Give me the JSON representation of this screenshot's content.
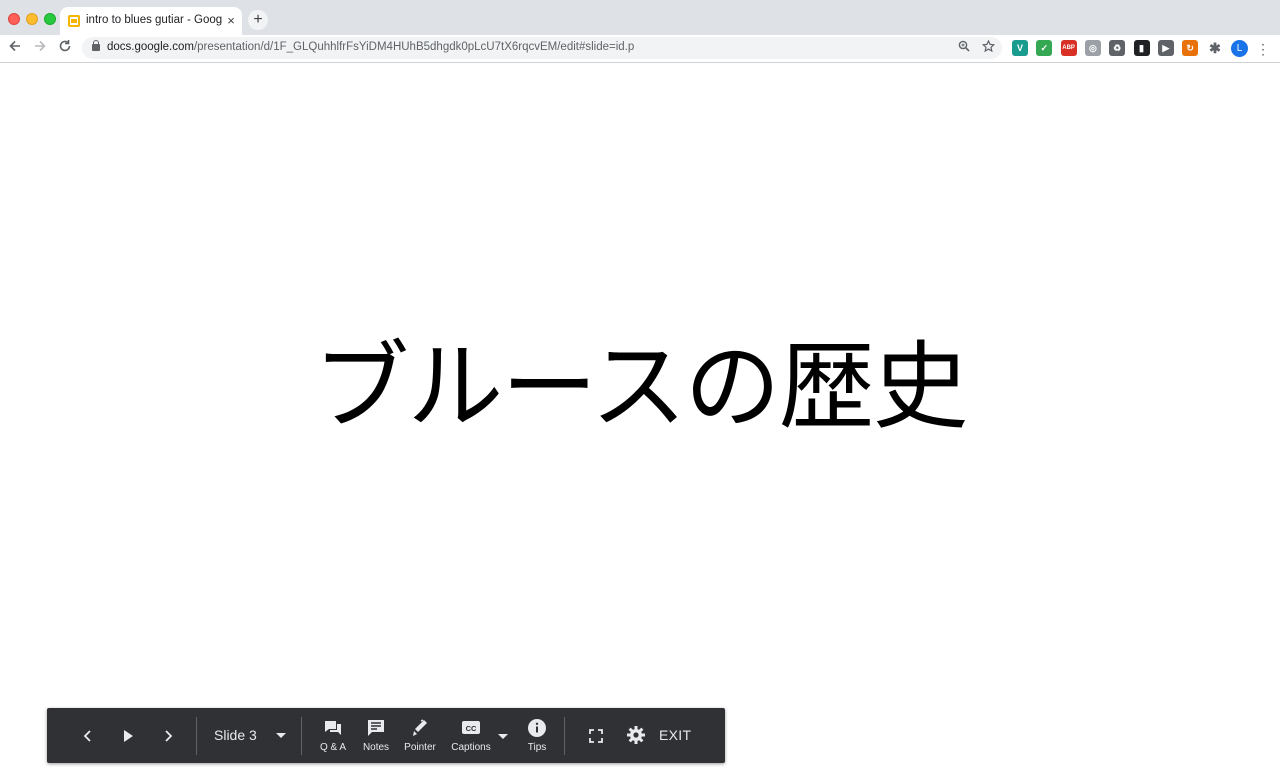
{
  "browser": {
    "tab_title": "intro to blues gutiar - Google S",
    "new_tab_symbol": "+",
    "close_symbol": "×",
    "url_host": "docs.google.com",
    "url_path": "/presentation/d/1F_GLQuhhlfrFsYiDM4HUhB5dhgdk0pLcU7tX6rqcvEM/edit#slide=id.p",
    "profile_initial": "L",
    "extensions": [
      {
        "name": "vimium-icon",
        "label": "V",
        "color": "#1a9b8f"
      },
      {
        "name": "todo-check-icon",
        "label": "✓",
        "color": "#34a853"
      },
      {
        "name": "adblock-plus-icon",
        "label": "ABP",
        "color": "#d93025"
      },
      {
        "name": "extension-gray-icon",
        "label": "◎",
        "color": "#9aa0a6"
      },
      {
        "name": "recycle-icon",
        "label": "♻",
        "color": "#5f6368"
      },
      {
        "name": "bookmark-book-icon",
        "label": "▮",
        "color": "#202124"
      },
      {
        "name": "play-circle-icon",
        "label": "▶",
        "color": "#5f6368"
      },
      {
        "name": "orange-extension-icon",
        "label": "↻",
        "color": "#e8710a"
      }
    ]
  },
  "slide": {
    "title": "ブルースの歴史"
  },
  "presenter": {
    "slide_label": "Slide 3",
    "tools": [
      {
        "name": "qa",
        "label": "Q & A"
      },
      {
        "name": "notes",
        "label": "Notes"
      },
      {
        "name": "pointer",
        "label": "Pointer"
      },
      {
        "name": "captions",
        "label": "Captions"
      },
      {
        "name": "tips",
        "label": "Tips"
      }
    ],
    "exit_label": "EXIT"
  },
  "colors": {
    "bar_background": "#303134",
    "bar_text": "#e8eaed",
    "tab_strip": "#dee1e6"
  }
}
